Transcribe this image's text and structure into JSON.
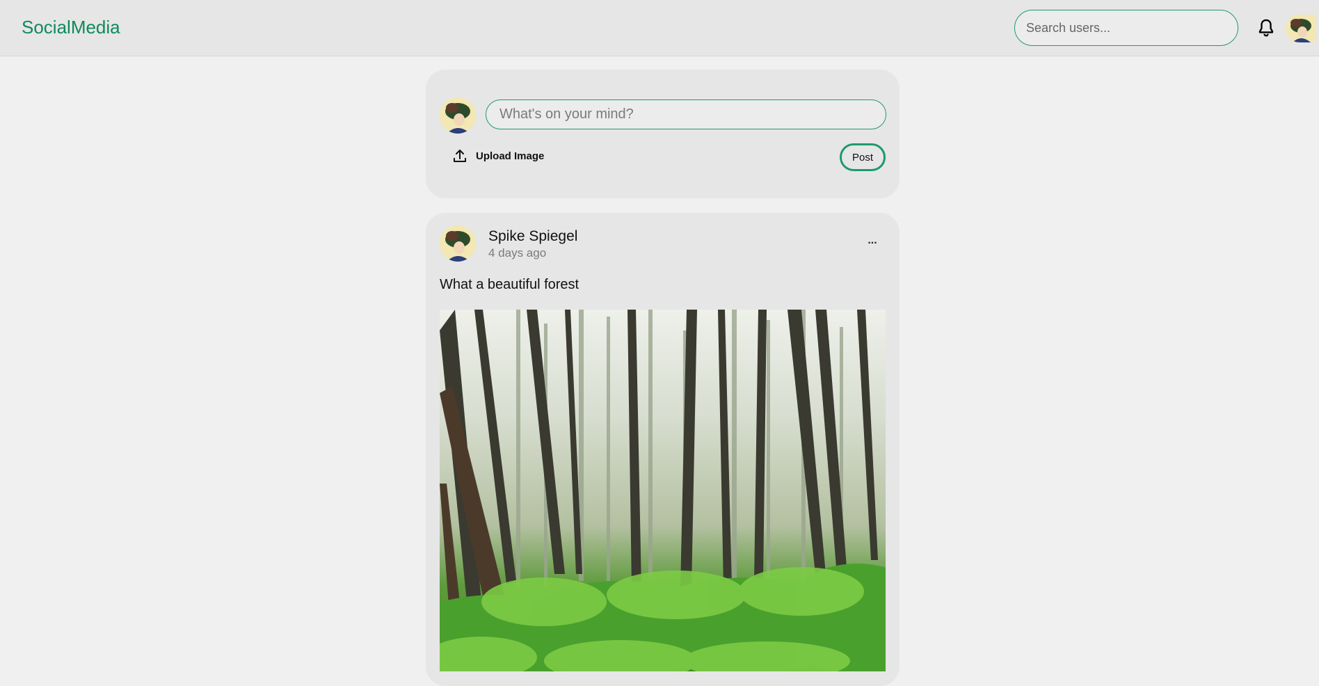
{
  "header": {
    "brand": "SocialMedia",
    "search_placeholder": "Search users..."
  },
  "composer": {
    "placeholder": "What's on your mind?",
    "upload_label": "Upload Image",
    "post_label": "Post"
  },
  "post": {
    "author": "Spike Spiegel",
    "time": "4 days ago",
    "more_label": "...",
    "caption": "What a beautiful forest"
  },
  "colors": {
    "accent": "#1e9a6b",
    "brand": "#0e8a5c",
    "page_bg": "#f0f0f0",
    "card_bg": "#e6e6e6"
  },
  "icons": [
    "bell-icon",
    "upload-icon",
    "more-icon"
  ]
}
